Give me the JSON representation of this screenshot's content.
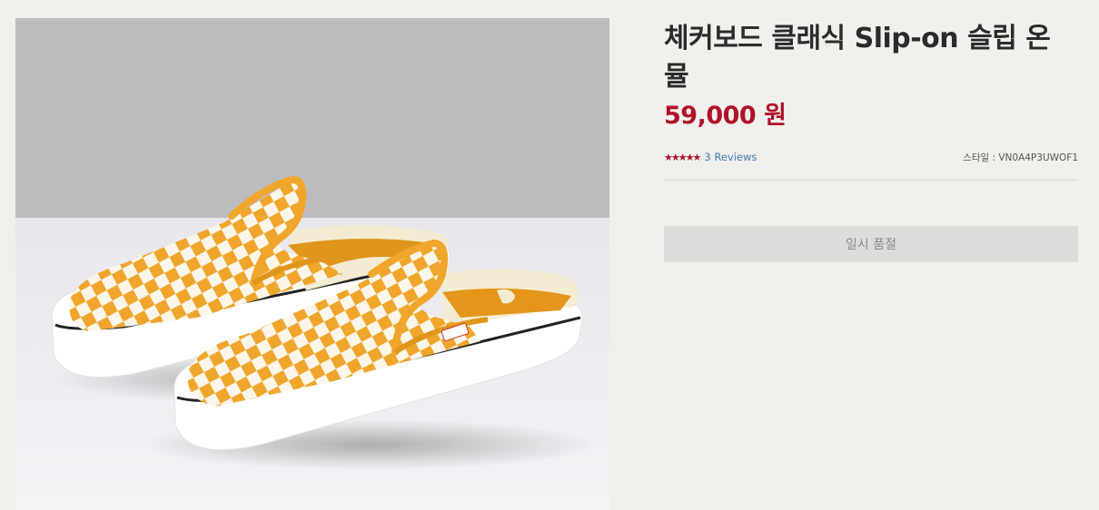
{
  "product": {
    "title": "체커보드 클래식 Slip-on 슬립 온 뮬",
    "price": "59,000 원",
    "rating": {
      "stars": 5,
      "reviews_label": "3 Reviews",
      "star_color": "#b0112a"
    },
    "style_code": "스타일 : VN0A4P3UWOF1",
    "soldout_label": "일시 품절",
    "image": {
      "alt": "Checkerboard yellow and white slip-on mule shoes",
      "icon": "product-photo"
    }
  },
  "colors": {
    "price": "#b0112a",
    "link": "#3d7bb0",
    "button_bg": "#dcdcda",
    "checker_yellow": "#f0a62c"
  }
}
